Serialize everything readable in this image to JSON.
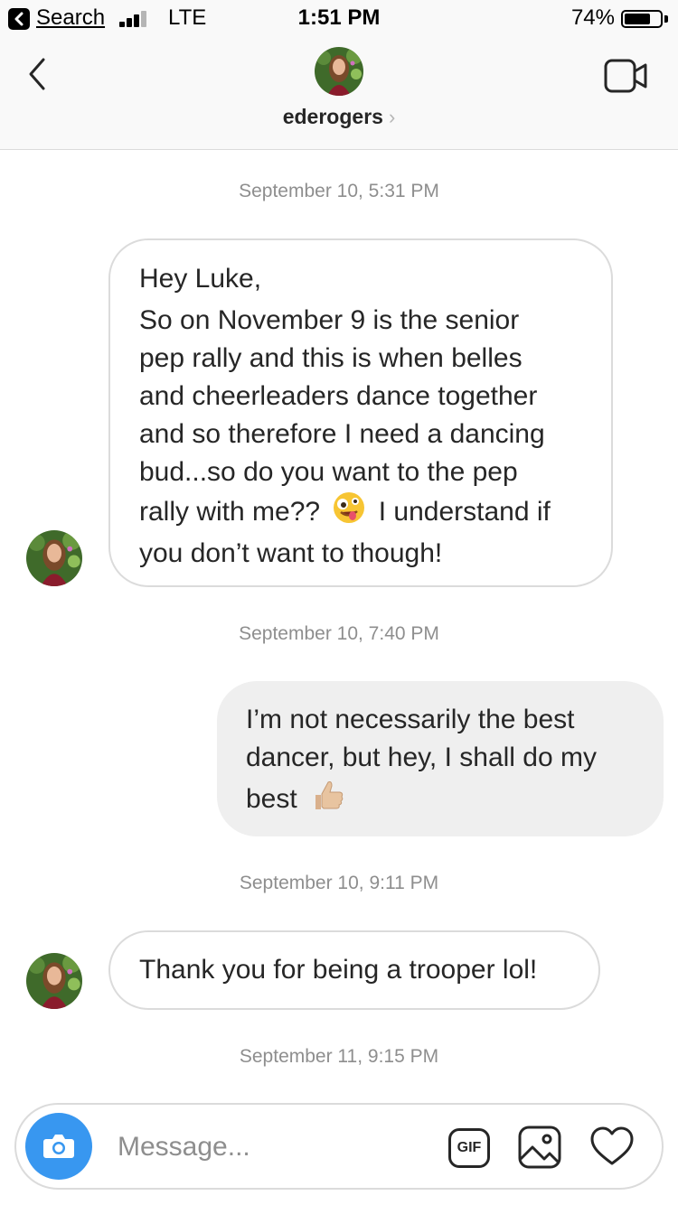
{
  "status_bar": {
    "back_app_label": "Search",
    "carrier": "LTE",
    "time": "1:51 PM",
    "battery_percent_text": "74%",
    "battery_level": 0.74
  },
  "header": {
    "username": "ederogers",
    "chevron": "›"
  },
  "thread": {
    "timestamps": [
      "September 10, 5:31 PM",
      "September 10, 7:40 PM",
      "September 10, 9:11 PM",
      "September 11, 9:15 PM"
    ],
    "message1": {
      "lines": [
        "Hey Luke,",
        "So on November 9 is the senior",
        "pep rally and this is when belles",
        "and cheerleaders dance together",
        "and so therefore I need a dancing",
        "bud...so do you want to the pep"
      ],
      "line7_before": "rally with me??",
      "line7_emoji": "zany-face-emoji",
      "line7_after": "I understand if",
      "line8": "you don’t want to though!"
    },
    "message2": {
      "lines": [
        "I’m not necessarily the best",
        "dancer, but hey, I shall do my"
      ],
      "line3": "best",
      "line3_emoji": "thumbs-up-emoji"
    },
    "message3": {
      "text": "Thank you for being a trooper lol!"
    }
  },
  "composer": {
    "placeholder": "Message...",
    "gif_label": "GIF"
  },
  "colors": {
    "accent_blue": "#3897f0",
    "outgoing_bubble": "#efefef",
    "border": "#dbdbdb",
    "timestamp": "#8e8e8e"
  },
  "icons": [
    "back-icon",
    "video-call-icon",
    "camera-icon",
    "gif-icon",
    "photo-icon",
    "heart-icon",
    "chevron-right-icon"
  ]
}
